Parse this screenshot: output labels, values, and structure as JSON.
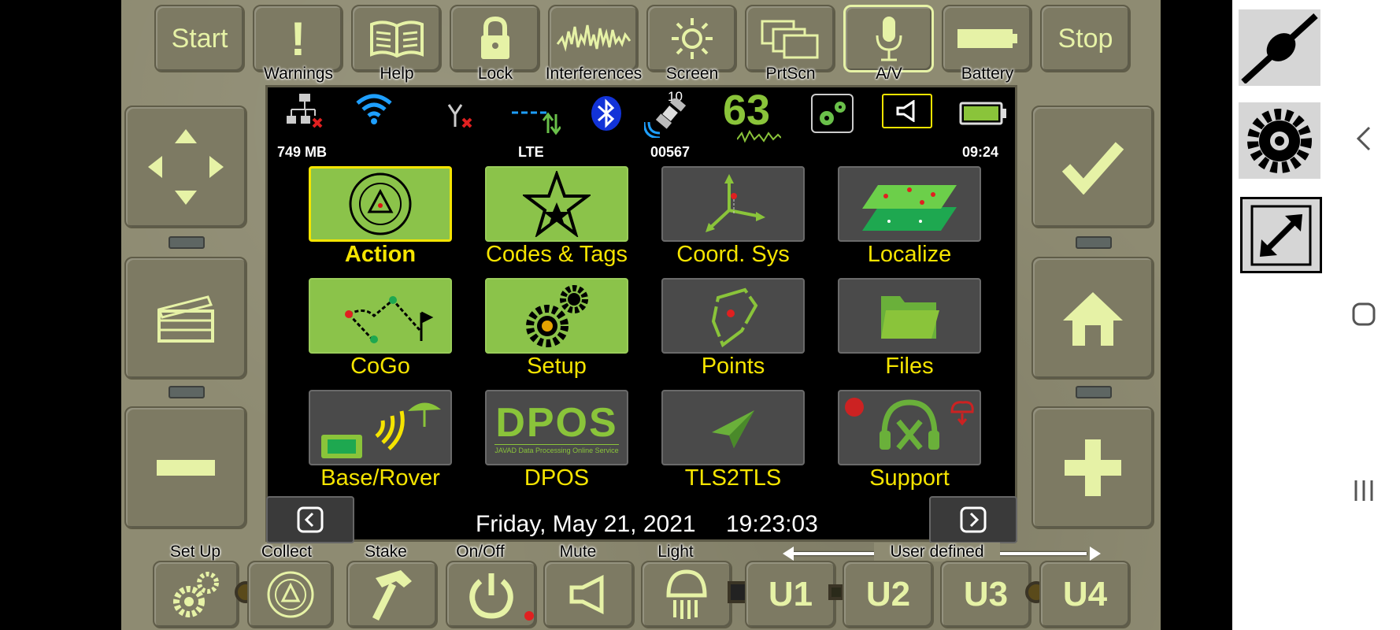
{
  "top_keys": [
    {
      "key": "start",
      "text": "Start",
      "label": ""
    },
    {
      "key": "warnings",
      "text": "!",
      "label": "Warnings"
    },
    {
      "key": "help",
      "text": "",
      "label": "Help"
    },
    {
      "key": "lock",
      "text": "",
      "label": "Lock"
    },
    {
      "key": "interferences",
      "text": "",
      "label": "Interferences"
    },
    {
      "key": "screen",
      "text": "",
      "label": "Screen"
    },
    {
      "key": "prtscn",
      "text": "",
      "label": "PrtScn"
    },
    {
      "key": "av",
      "text": "",
      "label": "A/V"
    },
    {
      "key": "battery",
      "text": "",
      "label": "Battery"
    },
    {
      "key": "stop",
      "text": "Stop",
      "label": ""
    }
  ],
  "status": {
    "memory": "749 MB",
    "network": "LTE",
    "satellite_count": "10",
    "satellite_id": "00567",
    "signal_value": "63",
    "time": "09:24"
  },
  "tiles": [
    {
      "label": "Action",
      "icon": "survey-marker-icon"
    },
    {
      "label": "Codes & Tags",
      "icon": "star-icon"
    },
    {
      "label": "Coord. Sys",
      "icon": "axes-icon"
    },
    {
      "label": "Localize",
      "icon": "layers-icon"
    },
    {
      "label": "CoGo",
      "icon": "traverse-icon"
    },
    {
      "label": "Setup",
      "icon": "gears-icon"
    },
    {
      "label": "Points",
      "icon": "polygon-point-icon"
    },
    {
      "label": "Files",
      "icon": "folder-icon"
    },
    {
      "label": "Base/Rover",
      "icon": "base-rover-icon"
    },
    {
      "label": "DPOS",
      "icon": "dpos-logo-icon"
    },
    {
      "label": "TLS2TLS",
      "icon": "paper-plane-icon"
    },
    {
      "label": "Support",
      "icon": "support-headset-icon"
    }
  ],
  "dpos_logo": {
    "title": "DPOS",
    "subtitle": "JAVAD Data Processing Online Service"
  },
  "datetime": {
    "date": "Friday, May 21, 2021",
    "time": "19:23:03"
  },
  "bottom_labels": {
    "setup": "Set Up",
    "collect": "Collect",
    "stake": "Stake",
    "onoff": "On/Off",
    "mute": "Mute",
    "light": "Light",
    "user_defined": "User defined"
  },
  "user_keys": [
    "U1",
    "U2",
    "U3",
    "U4"
  ],
  "colors": {
    "accent_yellow": "#f5e400",
    "tile_green": "#8bc34a",
    "key_glyph": "#e6f2a6",
    "body": "#8e8b72"
  }
}
